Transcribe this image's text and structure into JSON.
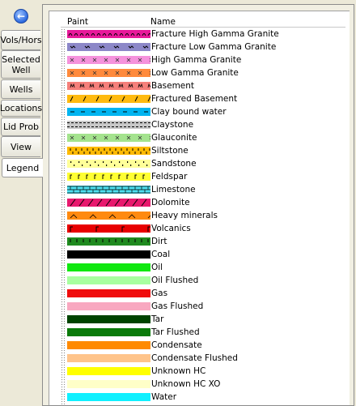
{
  "sidebar": {
    "tabs": [
      {
        "label": "Vols/Hors",
        "name": "tab-vols-hors"
      },
      {
        "label": "Selected Well",
        "name": "tab-selected-well"
      },
      {
        "label": "Wells",
        "name": "tab-wells"
      },
      {
        "label": "Locations",
        "name": "tab-locations"
      },
      {
        "label": "Lid Prob",
        "name": "tab-lid-prob"
      },
      {
        "label": "View",
        "name": "tab-view"
      },
      {
        "label": "Legend",
        "name": "tab-legend"
      }
    ],
    "active_tab": "Legend"
  },
  "legend": {
    "headers": {
      "paint": "Paint",
      "name": "Name"
    },
    "items": [
      {
        "name": "Fracture High Gamma Granite",
        "color": "#e8199a",
        "pattern": "wave-dense"
      },
      {
        "name": "Fracture Low Gamma Granite",
        "color": "#8c87c8",
        "pattern": "dash-sparse"
      },
      {
        "name": "High Gamma Granite",
        "color": "#f592dc",
        "pattern": "x-marks"
      },
      {
        "name": "Low Gamma Granite",
        "color": "#ff8a3c",
        "pattern": "x-marks"
      },
      {
        "name": "Basement",
        "color": "#f57f7a",
        "pattern": "m-marks"
      },
      {
        "name": "Fractured Basement",
        "color": "#ffba10",
        "pattern": "slashes"
      },
      {
        "name": "Clay bound water",
        "color": "#00b4f0",
        "pattern": "dashes"
      },
      {
        "name": "Claystone",
        "color": "#c8c8c8",
        "pattern": "dashed-lines"
      },
      {
        "name": "Glauconite",
        "color": "#a4e38e",
        "pattern": "x-marks"
      },
      {
        "name": "Siltstone",
        "color": "#ffba00",
        "pattern": "ticks"
      },
      {
        "name": "Sandstone",
        "color": "#ffff99",
        "pattern": "dots-sparse"
      },
      {
        "name": "Feldspar",
        "color": "#ffff33",
        "pattern": "f-marks"
      },
      {
        "name": "Limestone",
        "color": "#4ee0f0",
        "pattern": "bricks"
      },
      {
        "name": "Dolomite",
        "color": "#e8196e",
        "pattern": "slashes-dense"
      },
      {
        "name": "Heavy minerals",
        "color": "#ff8a10",
        "pattern": "chevrons"
      },
      {
        "name": "Volcanics",
        "color": "#e80000",
        "pattern": "v-marks"
      },
      {
        "name": "Dirt",
        "color": "#1f8a1f",
        "pattern": "ticks-dark"
      },
      {
        "name": "Coal",
        "color": "#000000",
        "pattern": "solid"
      },
      {
        "name": "Oil",
        "color": "#10e810",
        "pattern": "solid"
      },
      {
        "name": "Oil Flushed",
        "color": "#a8ffa0",
        "pattern": "solid"
      },
      {
        "name": "Gas",
        "color": "#f00c0c",
        "pattern": "solid"
      },
      {
        "name": "Gas Flushed",
        "color": "#f8a8c0",
        "pattern": "solid"
      },
      {
        "name": "Tar",
        "color": "#004400",
        "pattern": "solid"
      },
      {
        "name": "Tar Flushed",
        "color": "#0a7a0a",
        "pattern": "solid"
      },
      {
        "name": "Condensate",
        "color": "#ff8a00",
        "pattern": "solid"
      },
      {
        "name": "Condensate Flushed",
        "color": "#ffc48a",
        "pattern": "solid"
      },
      {
        "name": "Unknown HC",
        "color": "#ffff00",
        "pattern": "solid"
      },
      {
        "name": "Unknown HC XO",
        "color": "#ffffc8",
        "pattern": "solid"
      },
      {
        "name": "Water",
        "color": "#10f0ff",
        "pattern": "solid"
      }
    ]
  }
}
